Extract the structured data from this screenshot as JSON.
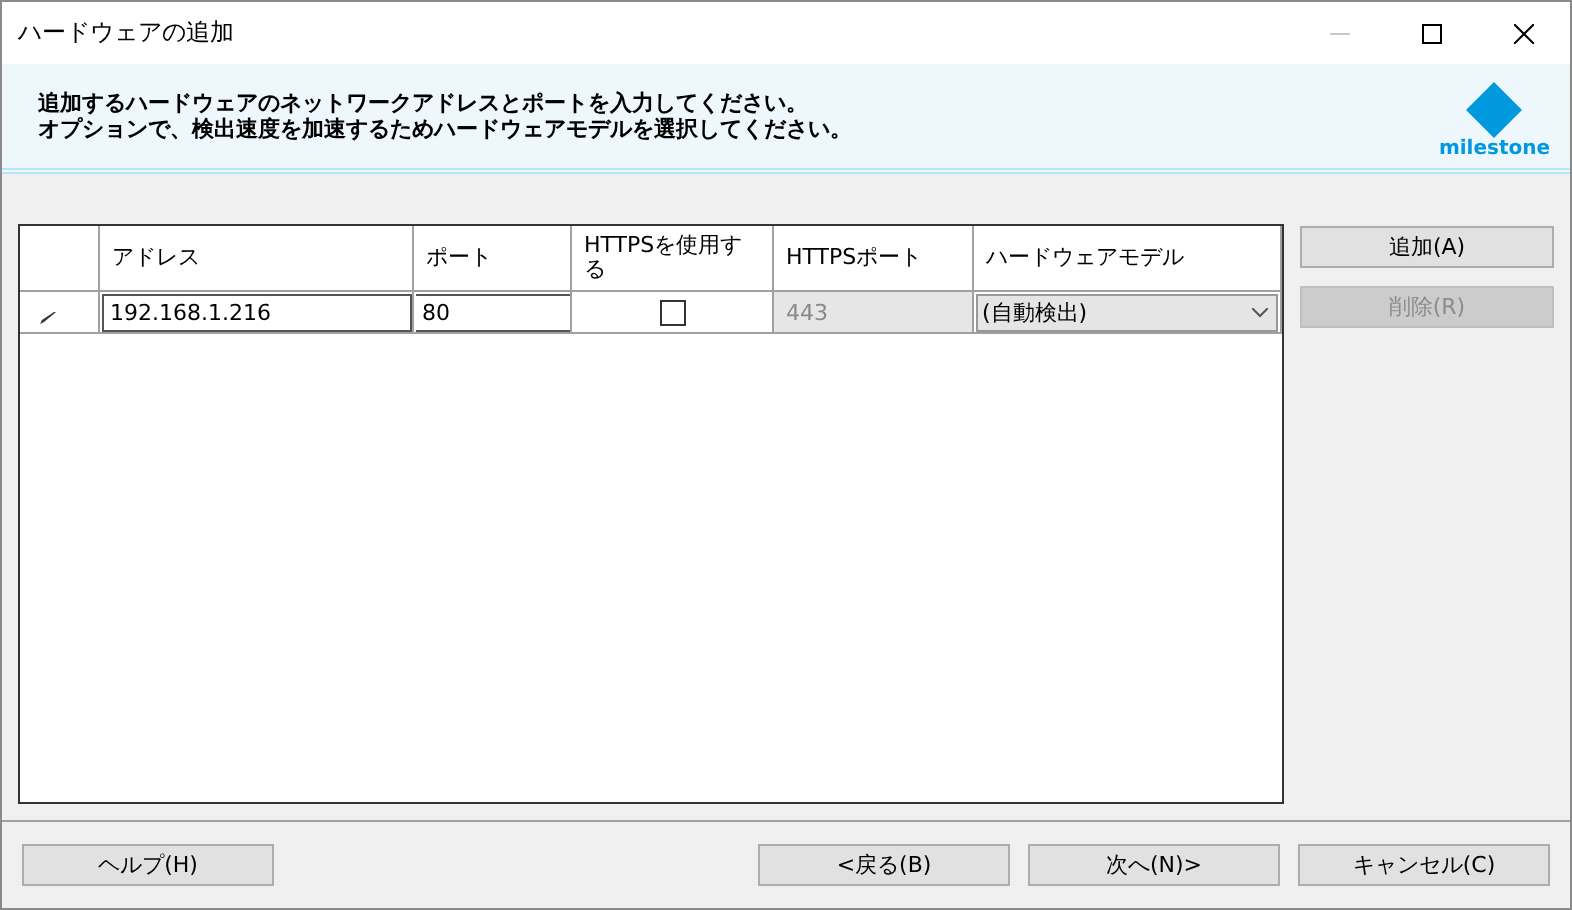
{
  "window": {
    "title": "ハードウェアの追加"
  },
  "header": {
    "instructions": [
      "追加するハードウェアのネットワークアドレスとポートを入力してください。",
      "オプションで、検出速度を加速するためハードウェアモデルを選択してください。"
    ],
    "logo_text": "milestone"
  },
  "table": {
    "columns": [
      "アドレス",
      "ポート",
      "HTTPSを使用する",
      "HTTPSポート",
      "ハードウェアモデル"
    ],
    "rows": [
      {
        "editing": true,
        "address": "192.168.1.216",
        "port": "80",
        "use_https": false,
        "https_port": "443",
        "https_port_disabled": true,
        "model": "(自動検出)"
      }
    ]
  },
  "side_buttons": [
    {
      "label": "追加(A)",
      "disabled": false
    },
    {
      "label": "削除(R)",
      "disabled": true
    }
  ],
  "footer_buttons": [
    {
      "label": "ヘルプ(H)",
      "kind": "left"
    },
    {
      "label": "<戻る(B)",
      "kind": "right"
    },
    {
      "label": "次へ(N)>",
      "kind": "right"
    },
    {
      "label": "キャンセル(C)",
      "kind": "right"
    }
  ]
}
